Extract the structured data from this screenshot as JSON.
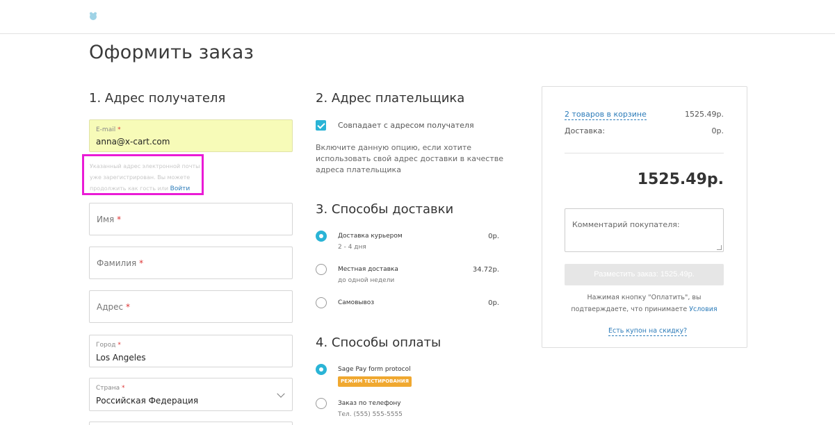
{
  "page": {
    "title": "Оформить заказ"
  },
  "address": {
    "section_title": "1. Адрес получателя",
    "email": {
      "label": "E-mail",
      "required_mark": "*",
      "value": "anna@x-cart.com"
    },
    "email_note": {
      "text": "Указанный адрес электронной почты уже зарегистрирован. Вы можете продолжить как гость или",
      "link": "Войти"
    },
    "first_name": {
      "placeholder": "Имя",
      "required_mark": "*"
    },
    "last_name": {
      "placeholder": "Фамилия",
      "required_mark": "*"
    },
    "street": {
      "placeholder": "Адрес",
      "required_mark": "*"
    },
    "city": {
      "label": "Город",
      "required_mark": "*",
      "value": "Los Angeles"
    },
    "country": {
      "label": "Страна",
      "required_mark": "*",
      "value": "Российская Федерация"
    }
  },
  "billing": {
    "section_title": "2. Адрес плательщика",
    "same_as_shipping_label": "Совпадает с адресом получателя",
    "same_as_shipping_checked": true,
    "hint": "Включите данную опцию, если хотите использовать свой адрес доставки в качестве адреса плательщика"
  },
  "shipping": {
    "section_title": "3. Способы доставки",
    "options": [
      {
        "name": "Доставка курьером",
        "sub": "2 - 4 дня",
        "price": "0р.",
        "selected": true
      },
      {
        "name": "Местная доставка",
        "sub": "до одной недели",
        "price": "34.72р.",
        "selected": false
      },
      {
        "name": "Самовывоз",
        "sub": "",
        "price": "0р.",
        "selected": false
      }
    ]
  },
  "payment": {
    "section_title": "4. Способы оплаты",
    "options": [
      {
        "name": "Sage Pay form protocol",
        "badge": "РЕЖИМ ТЕСТИРОВАНИЯ",
        "sub": "",
        "selected": true
      },
      {
        "name": "Заказ по телефону",
        "badge": "",
        "sub": "Тел. (555) 555-5555",
        "selected": false
      }
    ]
  },
  "summary": {
    "cart_link": "2 товаров в корзине",
    "cart_total": "1525.49р.",
    "shipping_label": "Доставка:",
    "shipping_value": "0р.",
    "total": "1525.49р.",
    "comment_placeholder": "Комментарий покупателя:",
    "place_order_button": "Разместить заказ: 1525.49р.",
    "terms_text": "Нажимая кнопку \"Оплатить\", вы подтверждаете, что принимаете",
    "terms_link": "Условия",
    "coupon_link": "Есть купон на скидку?"
  },
  "colors": {
    "accent": "#2ab4d6",
    "link": "#2b7bb9",
    "highlight_field": "#f7fbb8",
    "annotation_box": "#ea1bd6",
    "test_badge": "#f0a830"
  }
}
